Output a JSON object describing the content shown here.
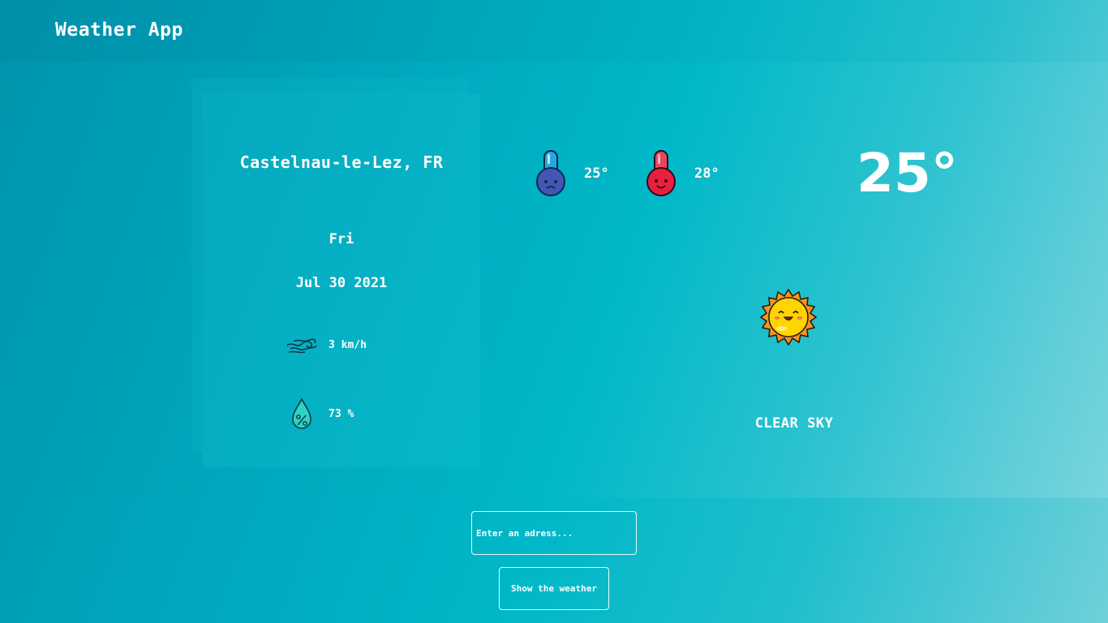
{
  "header": {
    "title": "Weather App"
  },
  "location": {
    "city": "Castelnau-le-Lez, FR"
  },
  "date": {
    "day": "Fri",
    "full": "Jul 30 2021"
  },
  "stats": {
    "wind": {
      "value": "3 km/h",
      "icon": "wind-icon"
    },
    "humidity": {
      "value": "73 %",
      "icon": "humidity-drop-icon"
    }
  },
  "temperature": {
    "min": {
      "value": "25°",
      "icon": "cold-thermometer-icon"
    },
    "max": {
      "value": "28°",
      "icon": "hot-thermometer-icon"
    },
    "current": "25°"
  },
  "condition": {
    "description": "CLEAR SKY",
    "icon": "sun-icon"
  },
  "search": {
    "placeholder": "Enter an adress...",
    "value": ""
  },
  "actions": {
    "show_label": "Show the weather"
  },
  "colors": {
    "background_start": "#0095ad",
    "background_end": "#6fd0da",
    "cold": "#3f51b5",
    "hot": "#e91e4b",
    "sun": "#ffc107"
  }
}
